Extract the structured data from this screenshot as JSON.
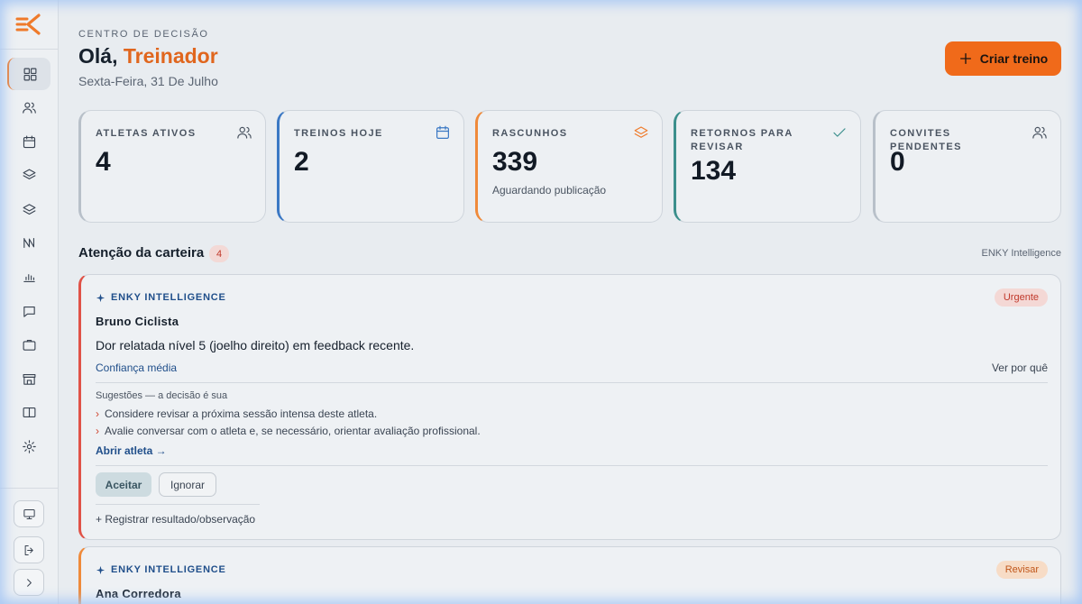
{
  "colors": {
    "accent": "#f06a1a",
    "brand_blue": "#1f4e8a",
    "urgent": "#e05247",
    "review": "#ef8a3a"
  },
  "sidebar": {
    "items": [
      {
        "icon": "dashboard-icon",
        "active": true
      },
      {
        "icon": "users-icon"
      },
      {
        "icon": "calendar-icon"
      },
      {
        "icon": "layers-icon"
      },
      {
        "icon": "stack-icon"
      },
      {
        "icon": "trend-icon"
      },
      {
        "icon": "bar-chart-icon"
      },
      {
        "icon": "chat-icon"
      },
      {
        "icon": "briefcase-icon"
      },
      {
        "icon": "store-icon"
      },
      {
        "icon": "book-icon"
      },
      {
        "icon": "settings-icon"
      }
    ],
    "bottom": [
      {
        "icon": "monitor-icon"
      },
      {
        "icon": "logout-icon"
      },
      {
        "icon": "chevron-right-icon"
      }
    ]
  },
  "header": {
    "eyebrow": "CENTRO DE DECISÃO",
    "greeting_prefix": "Olá,",
    "greeting_name": "Treinador",
    "date": "Sexta-Feira, 31 De Julho",
    "create_label": "Criar treino"
  },
  "stats": [
    {
      "label": "ATLETAS ATIVOS",
      "value": "4",
      "sub": "",
      "icon": "users-icon",
      "color": "#b8c0c9"
    },
    {
      "label": "TREINOS HOJE",
      "value": "2",
      "sub": "",
      "icon": "calendar-icon",
      "color": "#3b78c4"
    },
    {
      "label": "RASCUNHOS",
      "value": "339",
      "sub": "Aguardando publicação",
      "icon": "layers-icon",
      "color": "#ef8a3a"
    },
    {
      "label": "RETORNOS PARA REVISAR",
      "value": "134",
      "sub": "",
      "icon": "check-icon",
      "color": "#3b8f8c"
    },
    {
      "label": "CONVITES PENDENTES",
      "value": "0",
      "sub": "",
      "icon": "users-icon",
      "color": "#b8c0c9"
    }
  ],
  "attention": {
    "title": "Atenção da carteira",
    "count": "4",
    "right_label": "ENKY Intelligence",
    "alerts": [
      {
        "source": "ENKY INTELLIGENCE",
        "badge": "Urgente",
        "athlete": "Bruno Ciclista",
        "message": "Dor relatada nível 5 (joelho direito) em feedback recente.",
        "confidence": "Confiança média",
        "why": "Ver por quê",
        "suggestions_title": "Sugestões — a decisão é sua",
        "suggestions": [
          "Considere revisar a próxima sessão intensa deste atleta.",
          "Avalie conversar com o atleta e, se necessário, orientar avaliação profissional."
        ],
        "open": "Abrir atleta →",
        "accept": "Aceitar",
        "ignore": "Ignorar",
        "register": "+ Registrar resultado/observação"
      },
      {
        "source": "ENKY INTELLIGENCE",
        "badge": "Revisar",
        "athlete": "Ana Corredora"
      }
    ]
  }
}
